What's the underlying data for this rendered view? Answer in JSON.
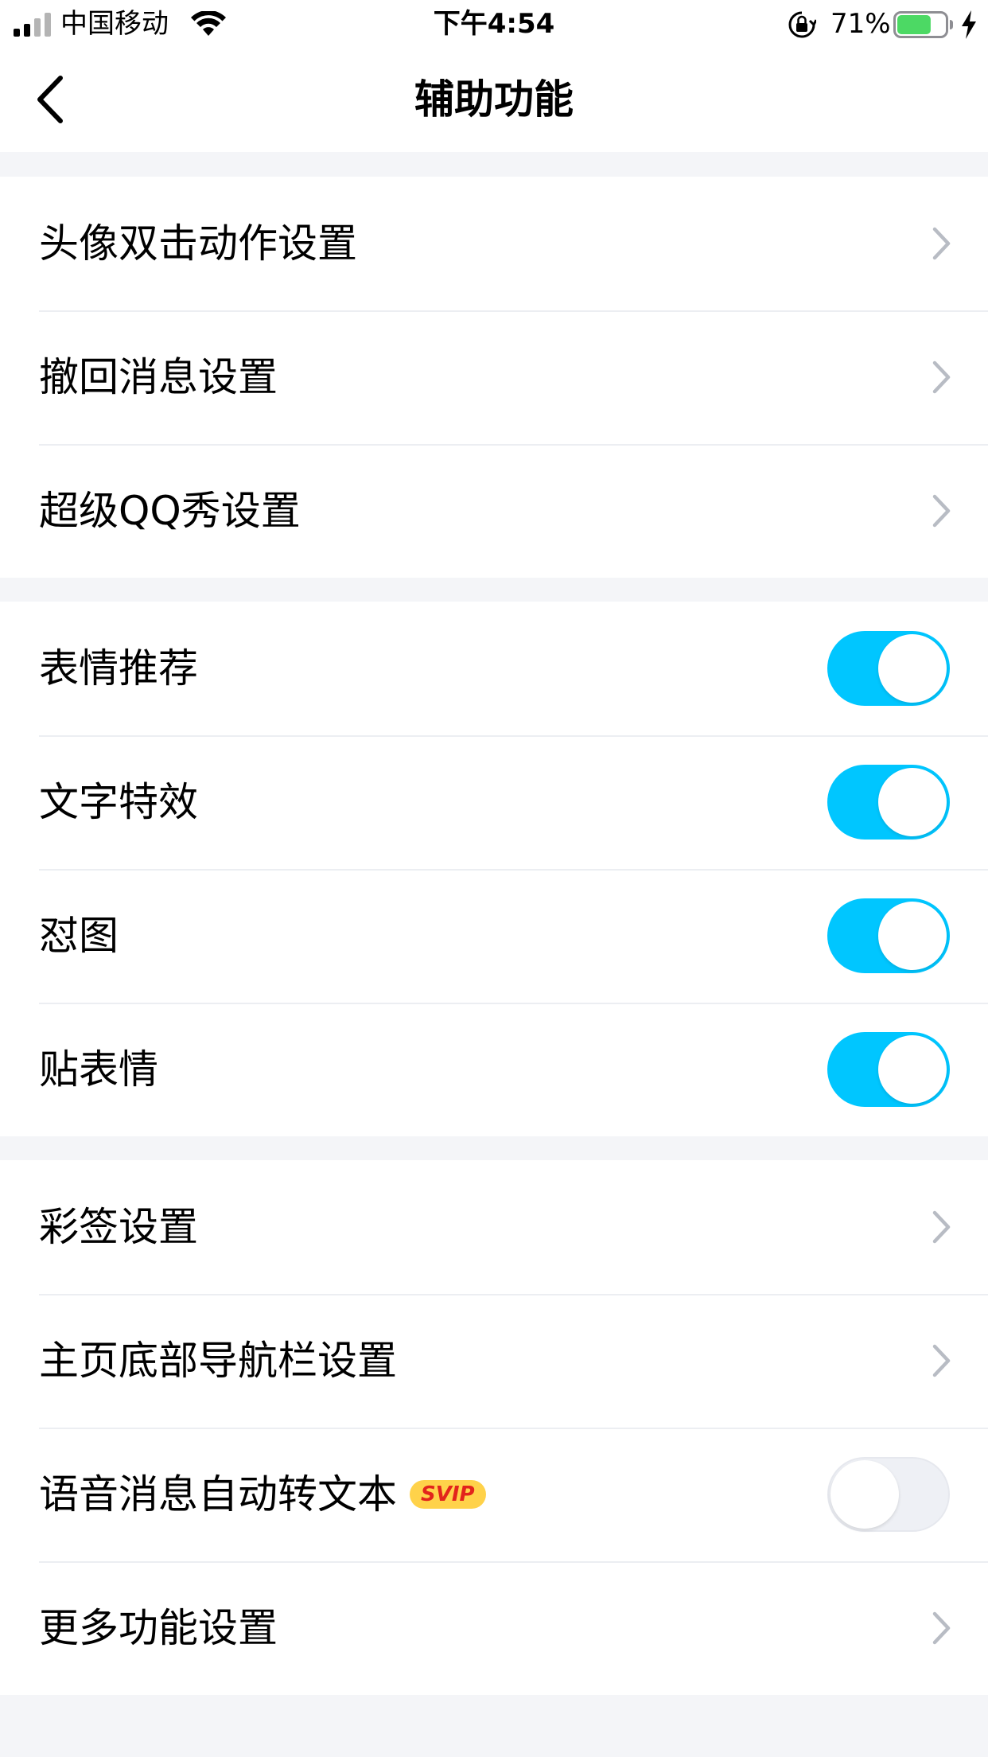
{
  "status_bar": {
    "carrier": "中国移动",
    "time": "下午4:54",
    "battery_percent": "71%",
    "battery_level": 0.71,
    "battery_color": "#4cd964"
  },
  "nav": {
    "title": "辅助功能",
    "back_icon": "chevron-left-icon"
  },
  "groups": [
    {
      "items": [
        {
          "label": "头像双击动作设置",
          "control": "chevron"
        },
        {
          "label": "撤回消息设置",
          "control": "chevron"
        },
        {
          "label": "超级QQ秀设置",
          "control": "chevron"
        }
      ]
    },
    {
      "items": [
        {
          "label": "表情推荐",
          "control": "toggle",
          "on": true
        },
        {
          "label": "文字特效",
          "control": "toggle",
          "on": true
        },
        {
          "label": "怼图",
          "control": "toggle",
          "on": true
        },
        {
          "label": "贴表情",
          "control": "toggle",
          "on": true
        }
      ]
    },
    {
      "items": [
        {
          "label": "彩签设置",
          "control": "chevron"
        },
        {
          "label": "主页底部导航栏设置",
          "control": "chevron"
        },
        {
          "label": "语音消息自动转文本",
          "badge": "SVIP",
          "control": "toggle",
          "on": false
        },
        {
          "label": "更多功能设置",
          "control": "chevron"
        }
      ]
    }
  ],
  "colors": {
    "toggle_on": "#00c6ff",
    "toggle_off": "#eef0f5",
    "background": "#f4f5f8",
    "svip_badge": "#ffd24a",
    "svip_text": "#e2241c"
  }
}
